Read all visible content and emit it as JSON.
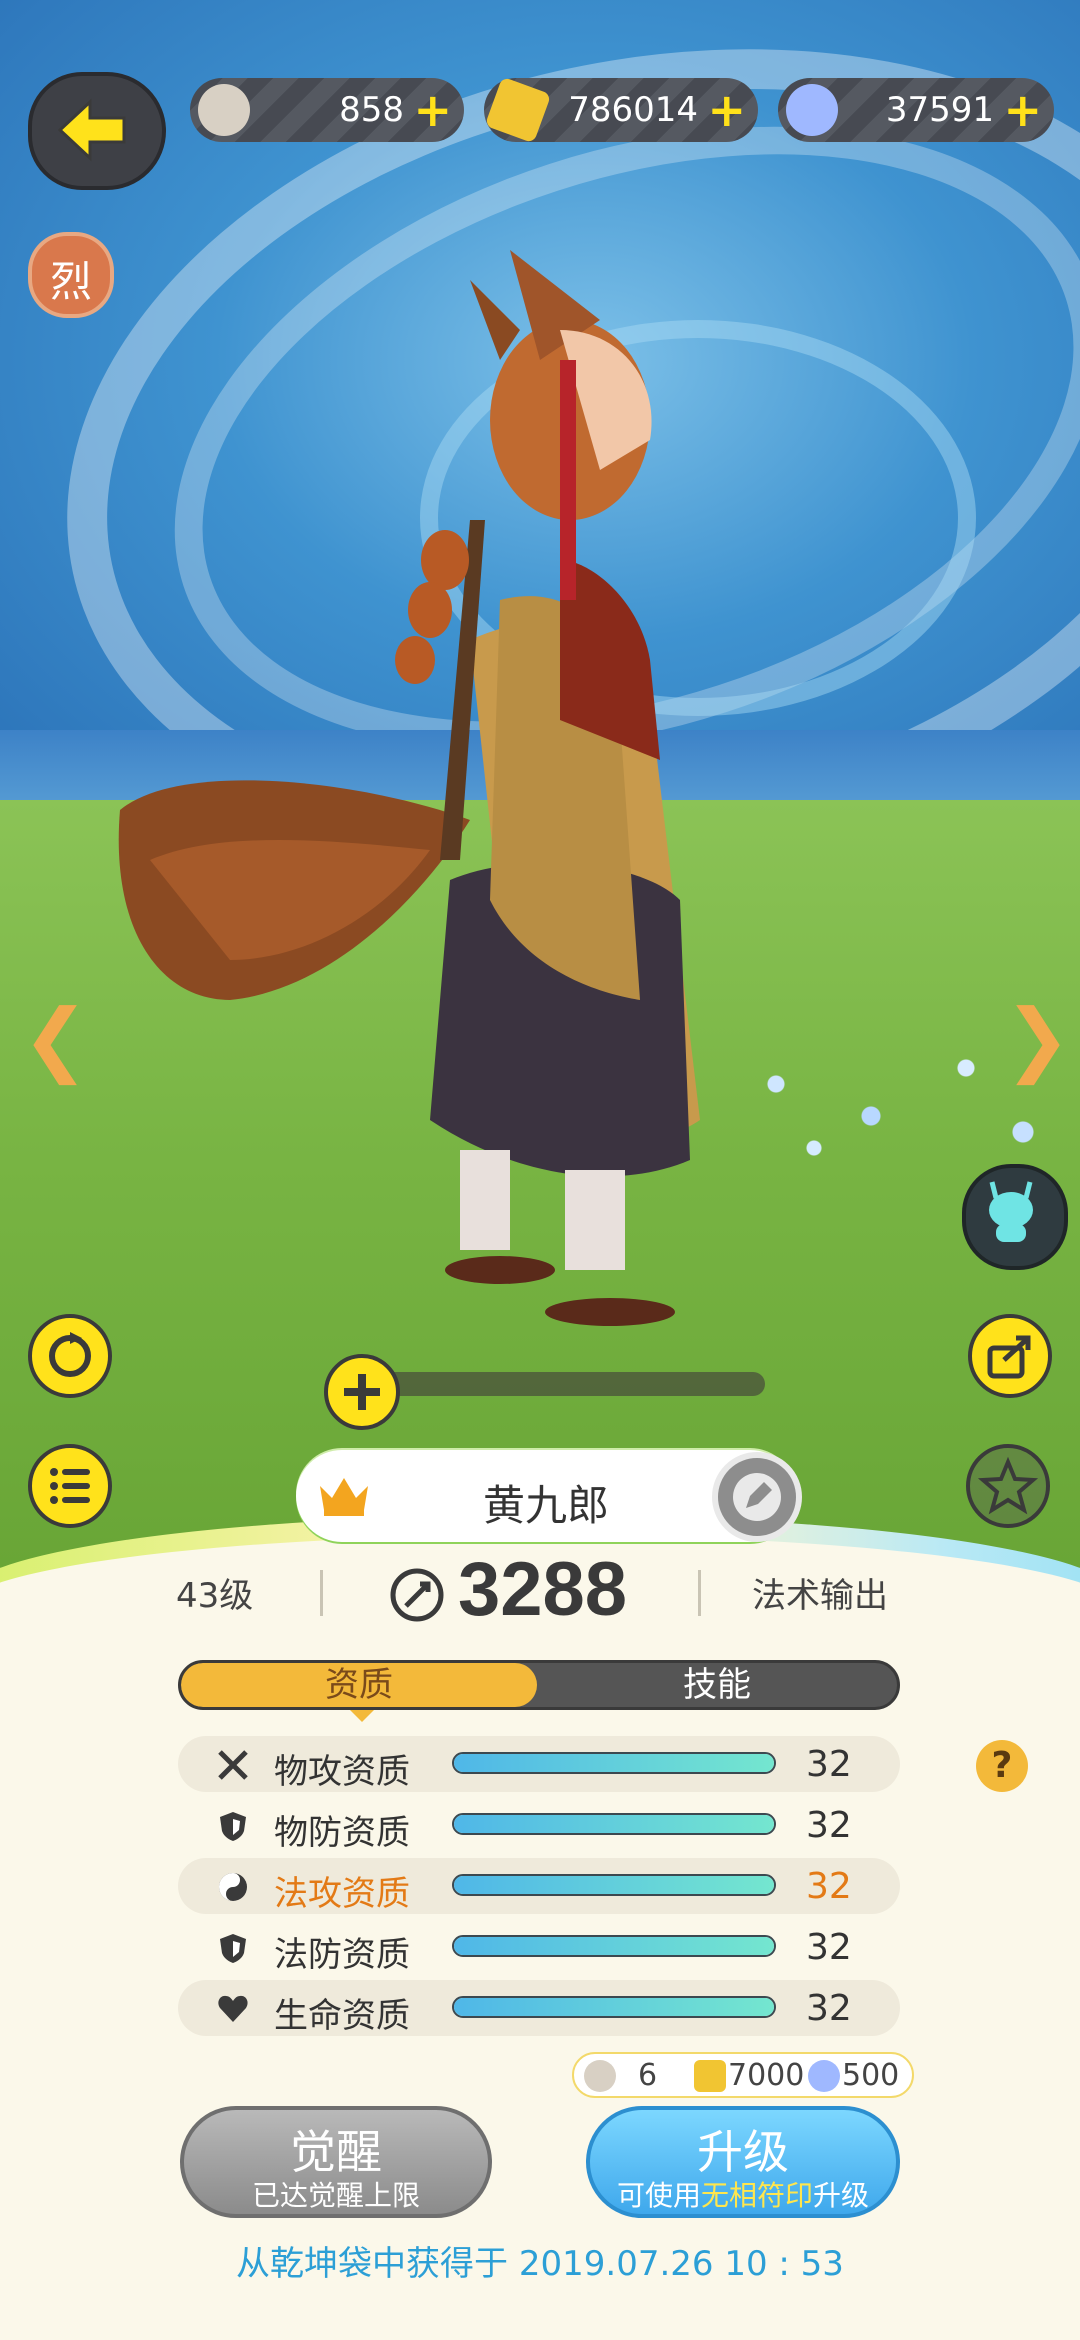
{
  "resources": [
    {
      "icon": "owl-coin-icon",
      "value": "858"
    },
    {
      "icon": "gold-crystal-icon",
      "value": "786014"
    },
    {
      "icon": "diamond-icon",
      "value": "37591"
    }
  ],
  "badge": {
    "text": "烈"
  },
  "pet": {
    "name": "黄九郎",
    "level": "43级",
    "power": "3288",
    "role": "法术输出"
  },
  "tabs": [
    {
      "label": "资质",
      "active": true
    },
    {
      "label": "技能",
      "active": false
    }
  ],
  "stats": [
    {
      "icon": "crossed-swords-icon",
      "label": "物攻资质",
      "value": "32",
      "fill": 1.0,
      "highlight": false
    },
    {
      "icon": "shield-icon",
      "label": "物防资质",
      "value": "32",
      "fill": 1.0,
      "highlight": false
    },
    {
      "icon": "taiji-icon",
      "label": "法攻资质",
      "value": "32",
      "fill": 1.0,
      "highlight": true
    },
    {
      "icon": "shield-icon",
      "label": "法防资质",
      "value": "32",
      "fill": 1.0,
      "highlight": false
    },
    {
      "icon": "heart-icon",
      "label": "生命资质",
      "value": "32",
      "fill": 1.0,
      "highlight": false
    }
  ],
  "help": "?",
  "cost": {
    "coin": "6",
    "crystal": "7000",
    "diamond": "500"
  },
  "awaken": {
    "title": "觉醒",
    "subtitle": "已达觉醒上限"
  },
  "upgrade": {
    "title": "升级",
    "sub_pre": "可使用",
    "sub_highlight": "无相符印",
    "sub_post": "升级"
  },
  "source": {
    "text": "从乾坤袋中获得于 2019.07.26    10 : 53"
  },
  "colors": {
    "accent_yellow": "#ffe21b",
    "highlight_orange": "#e37a16",
    "tab_active": "#f3b93a",
    "upgrade_blue": "#3fa8ec",
    "source_text": "#2c9fd6"
  }
}
